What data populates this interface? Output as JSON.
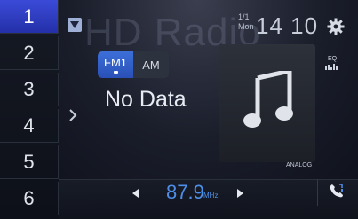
{
  "presets": [
    "1",
    "2",
    "3",
    "4",
    "5",
    "6"
  ],
  "active_preset": "1",
  "watermark": "HD Radio",
  "band": {
    "tabs": [
      "FM1",
      "AM"
    ],
    "active": "FM1"
  },
  "station_text": "No Data",
  "status": {
    "date_num": "1/1",
    "day": "Mon",
    "time": "14 10"
  },
  "eq_label": "EQ",
  "art_label": "ANALOG",
  "tuner": {
    "frequency": "87.9",
    "unit": "MHz"
  },
  "colors": {
    "accent": "#3b4bd8",
    "frequency": "#4d8fe8"
  }
}
